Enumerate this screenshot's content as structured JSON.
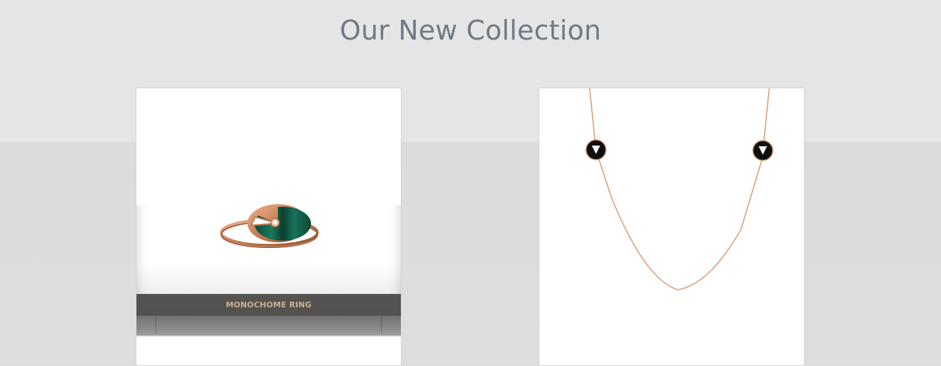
{
  "page": {
    "title": "Our New Collection"
  },
  "products": [
    {
      "name": "MONOCHOME RING",
      "image": "ring-image",
      "caption_visible": true
    },
    {
      "name": "",
      "image": "necklace-image",
      "caption_visible": false
    }
  ],
  "colors": {
    "title": "#6f7a86",
    "caption_text": "#cdb091",
    "caption_bar": "#444240",
    "rose_gold": "#c9865f",
    "malachite": "#0f5a44"
  }
}
